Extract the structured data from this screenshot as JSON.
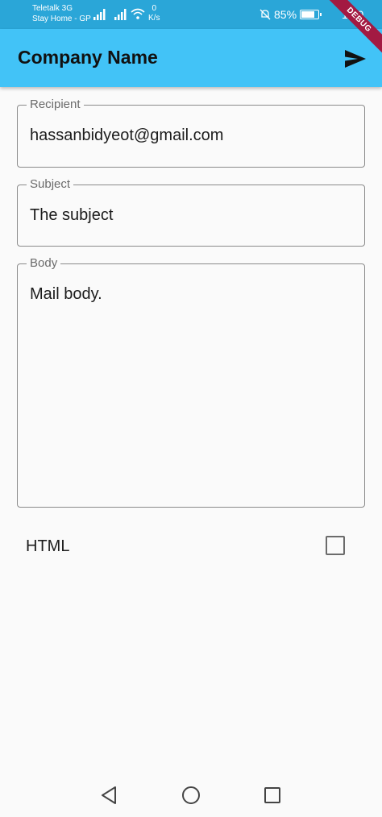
{
  "status_bar": {
    "carrier_line1": "Teletalk 3G",
    "carrier_line2": "Stay Home - GP",
    "speed_value": "0",
    "speed_unit": "K/s",
    "battery_percent": "85%",
    "battery_level": 0.85,
    "time": "12:0"
  },
  "debug_banner": "DEBUG",
  "app_bar": {
    "title": "Company Name",
    "send_icon": "send-icon",
    "color": "#42c3f7"
  },
  "form": {
    "recipient": {
      "label": "Recipient",
      "value": "hassanbidyeot@gmail.com"
    },
    "subject": {
      "label": "Subject",
      "value": "The subject"
    },
    "body": {
      "label": "Body",
      "value": "Mail body."
    },
    "html_toggle": {
      "label": "HTML",
      "checked": false
    }
  },
  "nav": {
    "back_icon": "back-triangle-icon",
    "home_icon": "home-circle-icon",
    "recents_icon": "recents-square-icon"
  }
}
